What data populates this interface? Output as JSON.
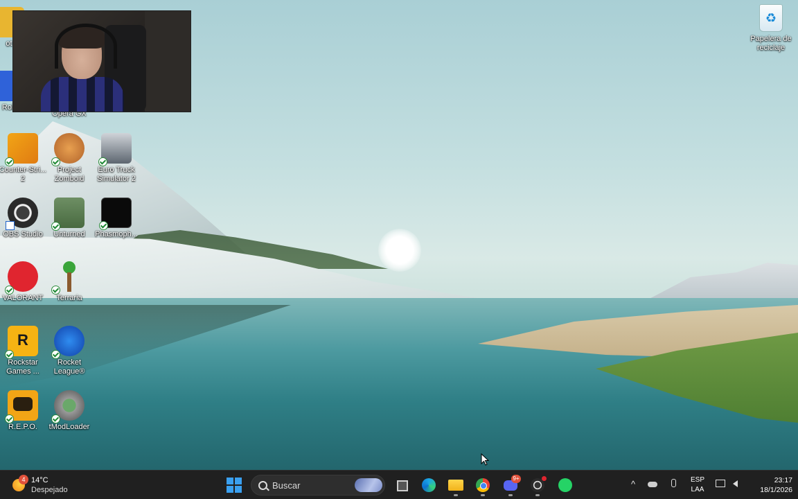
{
  "desktop": {
    "icons": [
      {
        "id": "cs2",
        "label": "Counter-Stri... 2"
      },
      {
        "id": "zomboid",
        "label": "Project Zomboid"
      },
      {
        "id": "ets2",
        "label": "Euro Truck Simulator 2"
      },
      {
        "id": "obs",
        "label": "OBS Studio"
      },
      {
        "id": "unturned",
        "label": "Unturned"
      },
      {
        "id": "phasmo",
        "label": "Phasmoph..."
      },
      {
        "id": "valorant",
        "label": "VALORANT"
      },
      {
        "id": "terraria",
        "label": "Terraria"
      },
      {
        "id": "rockstar",
        "label": "Rockstar Games ..."
      },
      {
        "id": "rocket",
        "label": "Rocket League®"
      },
      {
        "id": "repo",
        "label": "R.E.P.O."
      },
      {
        "id": "tmod",
        "label": "tModLoader"
      },
      {
        "id": "opera",
        "label": "Opera GX"
      },
      {
        "id": "ot",
        "label": "ot"
      },
      {
        "id": "rob",
        "label": "Rob"
      }
    ],
    "recycle_bin": {
      "label": "Papelera de reciclaje"
    }
  },
  "taskbar": {
    "weather": {
      "badge": "4",
      "temp": "14°C",
      "condition": "Despejado"
    },
    "search_placeholder": "Buscar",
    "discord_badge": "9+",
    "language": {
      "line1": "ESP",
      "line2": "LAA"
    },
    "clock": {
      "time": "23:17",
      "date": "18/1/2026"
    },
    "tray_overflow": "^"
  },
  "colors": {
    "taskbar_bg": "#202020",
    "accent": "#3aa0f0"
  }
}
